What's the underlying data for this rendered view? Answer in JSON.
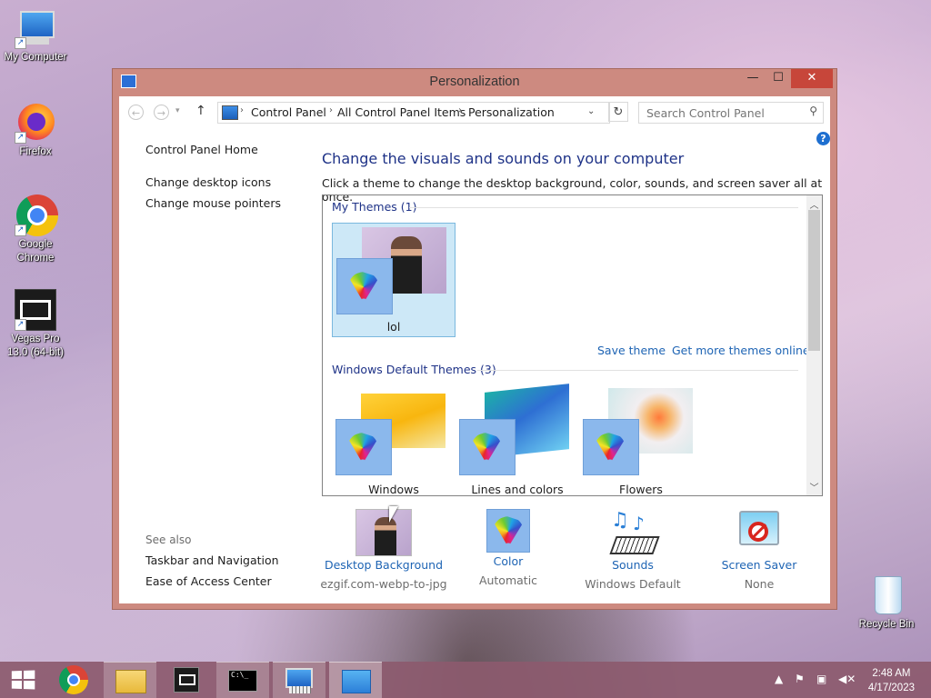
{
  "desktop": {
    "icons": [
      {
        "label": "My Computer",
        "icon": "computer-icon"
      },
      {
        "label": "Firefox",
        "icon": "firefox-icon"
      },
      {
        "label": "Google Chrome",
        "icon": "chrome-icon"
      },
      {
        "label": "Vegas Pro 13.0 (64-bit)",
        "icon": "film-icon"
      },
      {
        "label": "Recycle Bin",
        "icon": "recycle-bin-icon"
      }
    ]
  },
  "window": {
    "title": "Personalization",
    "controls": {
      "minimize": "—",
      "maximize": "☐",
      "close": "✕"
    }
  },
  "address": {
    "crumbs": [
      "Control Panel",
      "All Control Panel Items",
      "Personalization"
    ],
    "search_placeholder": "Search Control Panel"
  },
  "sidebar": {
    "home": "Control Panel Home",
    "links": [
      "Change desktop icons",
      "Change mouse pointers"
    ],
    "see_also_label": "See also",
    "see_also_links": [
      "Taskbar and Navigation",
      "Ease of Access Center"
    ]
  },
  "main": {
    "heading": "Change the visuals and sounds on your computer",
    "subheading": "Click a theme to change the desktop background, color, sounds, and screen saver all at once.",
    "my_themes_header": "My Themes (1)",
    "my_themes": [
      {
        "name": "lol",
        "selected": true
      }
    ],
    "links": {
      "save": "Save theme",
      "more": "Get more themes online"
    },
    "default_themes_header": "Windows Default Themes (3)",
    "default_themes": [
      {
        "name": "Windows"
      },
      {
        "name": "Lines and colors"
      },
      {
        "name": "Flowers"
      }
    ]
  },
  "bottom": [
    {
      "label": "Desktop Background",
      "value": "ezgif.com-webp-to-jpg",
      "icon": "desktop-background-icon"
    },
    {
      "label": "Color",
      "value": "Automatic",
      "icon": "color-palette-icon"
    },
    {
      "label": "Sounds",
      "value": "Windows Default",
      "icon": "sounds-icon"
    },
    {
      "label": "Screen Saver",
      "value": "None",
      "icon": "screen-saver-icon"
    }
  ],
  "taskbar": {
    "time": "2:48 AM",
    "date": "4/17/2023",
    "buttons": [
      "start-icon",
      "chrome-icon",
      "file-explorer-icon",
      "vegas-icon",
      "cmd-icon",
      "on-screen-keyboard-icon",
      "control-panel-icon"
    ]
  },
  "colors": {
    "title_bar": "#cd8a80",
    "close_button": "#c7463a",
    "link": "#1e64b4",
    "heading": "#1e3287",
    "selection": "#cde8f7"
  }
}
